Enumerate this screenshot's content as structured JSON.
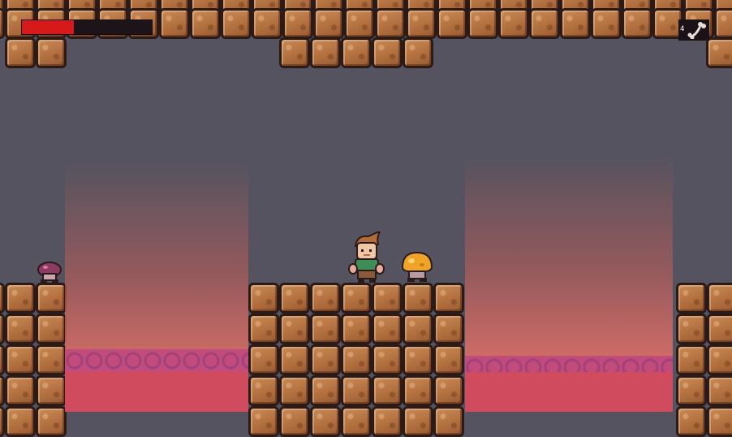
{
  "hud": {
    "health": {
      "current": 0.4
    },
    "ammo": {
      "count": "4",
      "icon": "bone-icon"
    }
  },
  "colors": {
    "background": "#55535f",
    "dirt": "#b3703f",
    "lava_surface": "#c14b7b",
    "lava_pool": "#d14b5e",
    "health_fill": "#d61a1a"
  },
  "entities": [
    {
      "name": "player-character",
      "kind": "player"
    },
    {
      "name": "orange-mushroom-enemy",
      "kind": "enemy"
    },
    {
      "name": "purple-mushroom-enemy",
      "kind": "enemy"
    }
  ]
}
